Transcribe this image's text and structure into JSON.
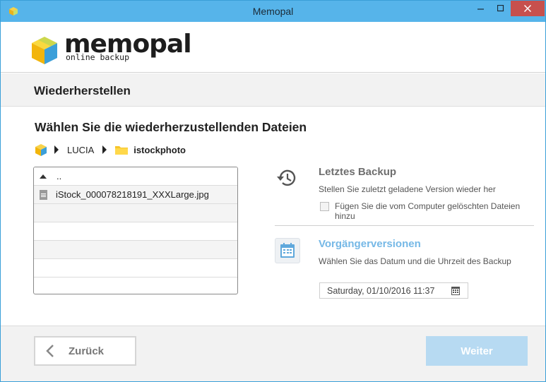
{
  "window": {
    "title": "Memopal"
  },
  "logo": {
    "word": "memopal",
    "sub": "online backup"
  },
  "section": {
    "title": "Wiederherstellen"
  },
  "content": {
    "heading": "Wählen Sie die wiederherzustellenden Dateien"
  },
  "breadcrumb": {
    "computer": "LUCIA",
    "folder": "istockphoto"
  },
  "filelist": {
    "up_label": "..",
    "files": [
      "iStock_000078218191_XXXLarge.jpg"
    ]
  },
  "latest_backup": {
    "title": "Letztes Backup",
    "description": "Stellen Sie zuletzt geladene Version wieder her",
    "checkbox_label": "Fügen Sie die vom Computer gelöschten Dateien hinzu",
    "checked": false
  },
  "previous_versions": {
    "title": "Vorgängerversionen",
    "description": "Wählen Sie das Datum und die Uhrzeit des Backup",
    "datetime": "Saturday, 01/10/2016 11:37"
  },
  "footer": {
    "back_label": "Zurück",
    "next_label": "Weiter"
  },
  "colors": {
    "titlebar": "#56b4ea",
    "close_button": "#c7504d",
    "accent_link": "#75b8e6",
    "next_button_disabled": "#b7daf2"
  },
  "icons": {
    "app": "memopal-cube-icon",
    "minimize": "minimize-icon",
    "maximize": "maximize-icon",
    "close": "close-icon",
    "history": "history-icon",
    "calendar": "calendar-icon",
    "folder": "folder-icon",
    "file": "file-icon",
    "back": "chevron-left-icon"
  }
}
